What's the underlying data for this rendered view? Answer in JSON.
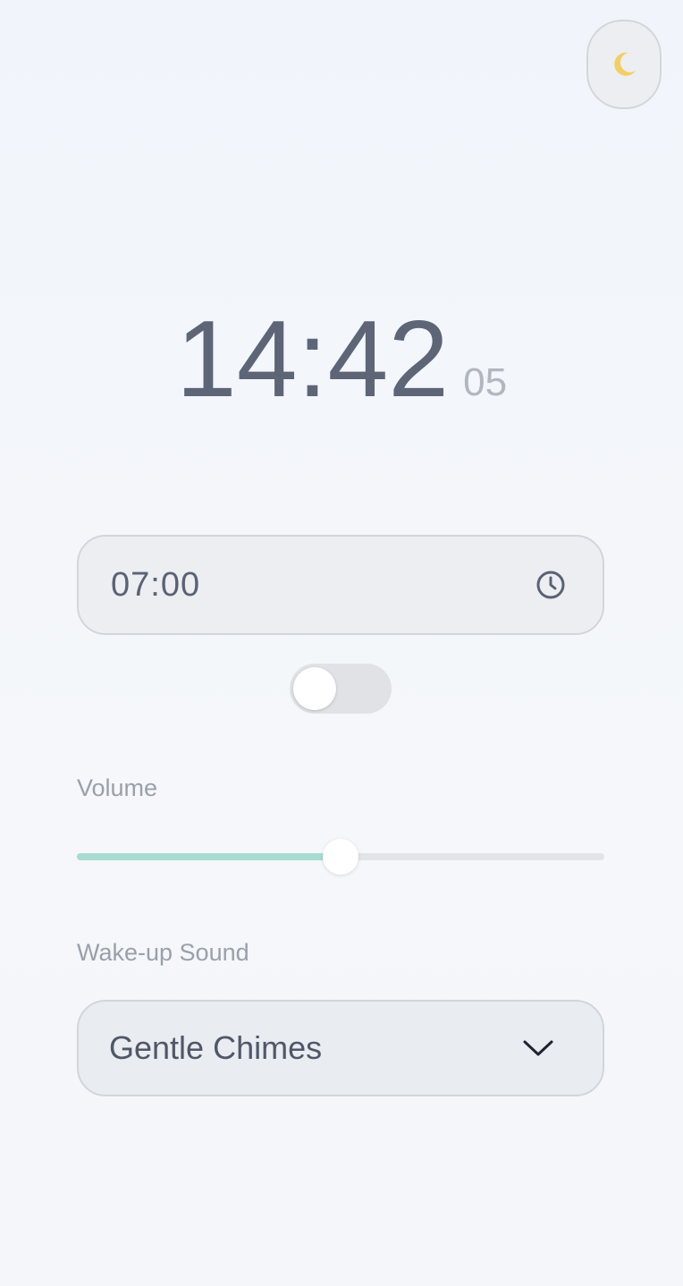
{
  "theme_toggle": {
    "icon": "moon-icon"
  },
  "clock": {
    "hours_minutes": "14:42",
    "seconds": "05"
  },
  "alarm": {
    "time": "07:00",
    "icon": "clock-icon",
    "enabled": false
  },
  "volume": {
    "label": "Volume",
    "value": 0.5
  },
  "sound": {
    "label": "Wake-up Sound",
    "selected": "Gentle Chimes",
    "icon": "chevron-down-icon"
  },
  "colors": {
    "accent": "#a8dcd1",
    "moon": "#f2cf62",
    "text": "#5d6577"
  }
}
